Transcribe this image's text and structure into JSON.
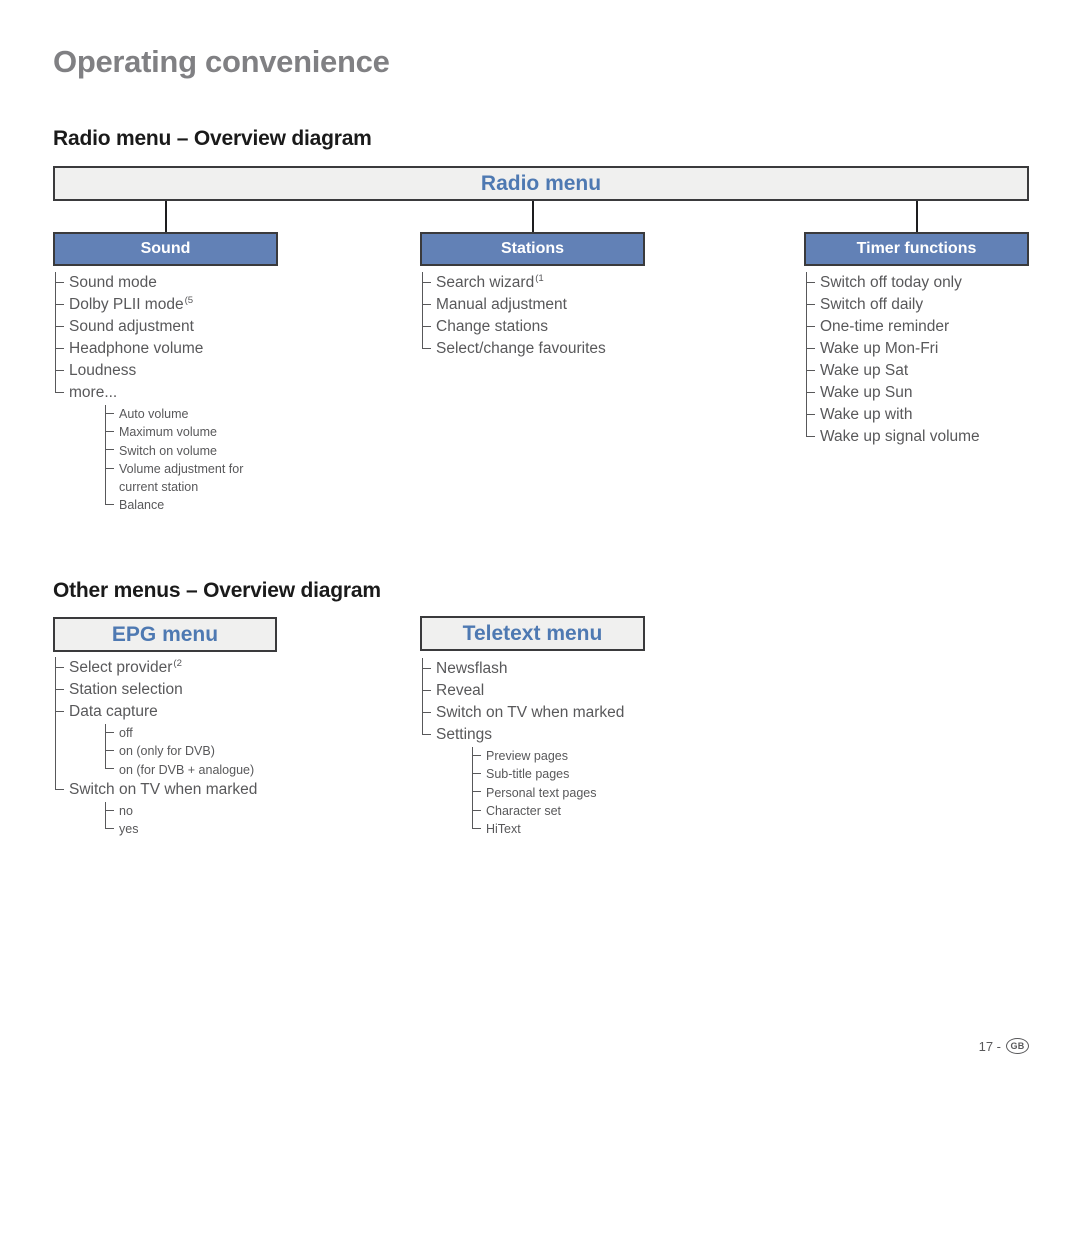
{
  "page": {
    "title": "Operating convenience",
    "footer_page": "17 -",
    "footer_region": "GB"
  },
  "sections": [
    {
      "id": "radio",
      "title": "Radio menu – Overview diagram"
    },
    {
      "id": "other",
      "title": "Other menus – Overview diagram"
    }
  ],
  "colors": {
    "root_box_fill": "#f0f0ef",
    "root_box_text": "#4e79b2",
    "child_box_fill": "#6281b6",
    "child_box_text": "#ffffff",
    "box_border": "#3a3a3c",
    "tree_text": "#58585a",
    "title_text": "#808083"
  },
  "radio_diagram": {
    "root": "Radio menu",
    "columns": [
      {
        "header": "Sound",
        "items": [
          {
            "label": "Sound mode"
          },
          {
            "label": "Dolby PLII mode",
            "sup": "(5"
          },
          {
            "label": "Sound adjustment"
          },
          {
            "label": "Headphone volume"
          },
          {
            "label": "Loudness"
          },
          {
            "label": "more...",
            "children": [
              {
                "label": "Auto volume"
              },
              {
                "label": "Maximum volume"
              },
              {
                "label": "Switch on volume"
              },
              {
                "label": "Volume adjustment for\ncurrent station"
              },
              {
                "label": "Balance"
              }
            ]
          }
        ]
      },
      {
        "header": "Stations",
        "items": [
          {
            "label": "Search wizard",
            "sup": "(1"
          },
          {
            "label": "Manual adjustment"
          },
          {
            "label": "Change stations"
          },
          {
            "label": "Select/change favourites"
          }
        ]
      },
      {
        "header": "Timer functions",
        "items": [
          {
            "label": "Switch off today only"
          },
          {
            "label": "Switch off daily"
          },
          {
            "label": "One-time reminder"
          },
          {
            "label": "Wake up Mon-Fri"
          },
          {
            "label": "Wake up Sat"
          },
          {
            "label": "Wake up Sun"
          },
          {
            "label": "Wake up with"
          },
          {
            "label": "Wake up signal volume"
          }
        ]
      }
    ]
  },
  "other_diagrams": [
    {
      "header": "EPG menu",
      "items": [
        {
          "label": "Select provider",
          "sup": "(2"
        },
        {
          "label": "Station selection"
        },
        {
          "label": "Data capture",
          "children": [
            {
              "label": "off"
            },
            {
              "label": "on (only for DVB)"
            },
            {
              "label": "on (for DVB + analogue)"
            }
          ]
        },
        {
          "label": "Switch on TV when marked",
          "children": [
            {
              "label": "no"
            },
            {
              "label": "yes"
            }
          ]
        }
      ]
    },
    {
      "header": "Teletext menu",
      "items": [
        {
          "label": "Newsflash"
        },
        {
          "label": "Reveal"
        },
        {
          "label": "Switch on TV when marked"
        },
        {
          "label": "Settings",
          "children": [
            {
              "label": "Preview pages"
            },
            {
              "label": "Sub-title pages"
            },
            {
              "label": "Personal text pages"
            },
            {
              "label": "Character set"
            },
            {
              "label": "HiText"
            }
          ]
        }
      ]
    }
  ]
}
